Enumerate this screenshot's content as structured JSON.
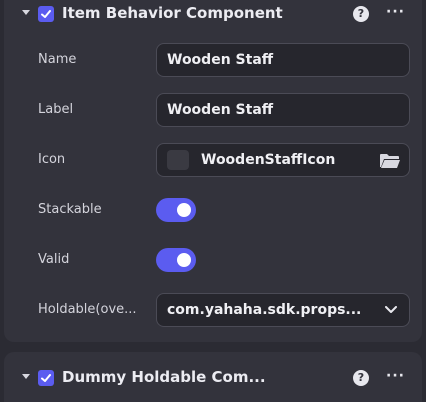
{
  "component1": {
    "title": "Item Behavior Component",
    "help_icon": "help-icon",
    "more_icon": "more-icon",
    "fields": {
      "name_label": "Name",
      "name_value": "Wooden Staff",
      "label_label": "Label",
      "label_value": "Wooden Staff",
      "icon_label": "Icon",
      "icon_value": "WoodenStaffIcon",
      "stackable_label": "Stackable",
      "stackable_on": true,
      "valid_label": "Valid",
      "valid_on": true,
      "holdable_label": "Holdable(ove...",
      "holdable_value": "com.yahaha.sdk.props..."
    }
  },
  "component2": {
    "title": "Dummy Holdable Com..."
  },
  "colors": {
    "accent": "#5b5cf0",
    "panel": "#33333c",
    "background": "#2b2b33"
  }
}
